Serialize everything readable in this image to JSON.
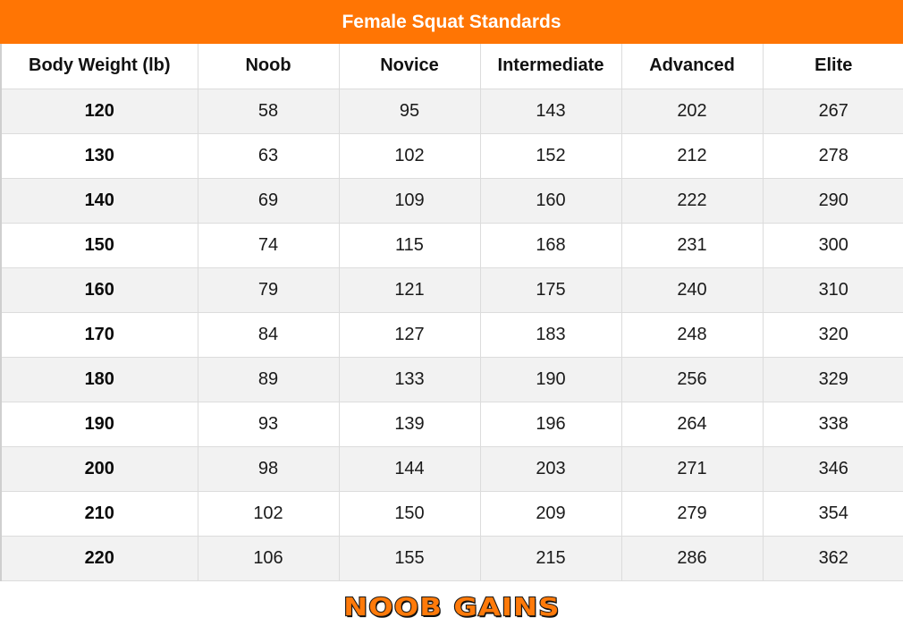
{
  "chart_data": {
    "type": "table",
    "title": "Female Squat Standards",
    "columns": [
      "Body Weight (lb)",
      "Noob",
      "Novice",
      "Intermediate",
      "Advanced",
      "Elite"
    ],
    "rows": [
      [
        "120",
        "58",
        "95",
        "143",
        "202",
        "267"
      ],
      [
        "130",
        "63",
        "102",
        "152",
        "212",
        "278"
      ],
      [
        "140",
        "69",
        "109",
        "160",
        "222",
        "290"
      ],
      [
        "150",
        "74",
        "115",
        "168",
        "231",
        "300"
      ],
      [
        "160",
        "79",
        "121",
        "175",
        "240",
        "310"
      ],
      [
        "170",
        "84",
        "127",
        "183",
        "248",
        "320"
      ],
      [
        "180",
        "89",
        "133",
        "190",
        "256",
        "329"
      ],
      [
        "190",
        "93",
        "139",
        "196",
        "264",
        "338"
      ],
      [
        "200",
        "98",
        "144",
        "203",
        "271",
        "346"
      ],
      [
        "210",
        "102",
        "150",
        "209",
        "279",
        "354"
      ],
      [
        "220",
        "106",
        "155",
        "215",
        "286",
        "362"
      ]
    ]
  },
  "colors": {
    "title_background": "#ff7504",
    "title_text": "#ffffff",
    "row_alt_background": "#f2f2f2",
    "logo_fill": "#ff7a0a"
  },
  "logo": {
    "text": "NOOB GAINS"
  }
}
